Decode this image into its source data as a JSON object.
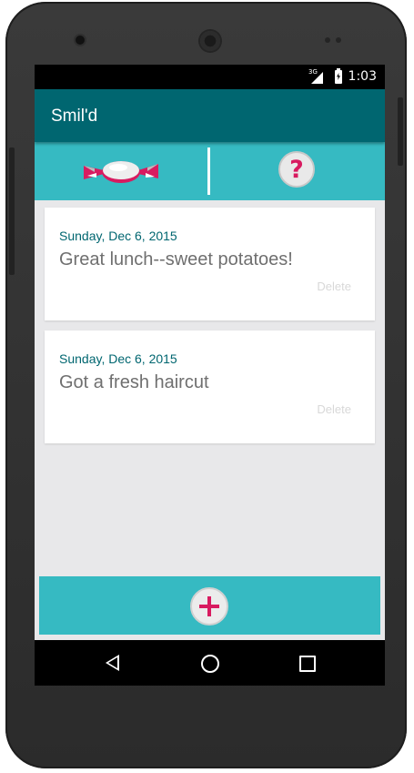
{
  "status_bar": {
    "network_label": "3G",
    "time": "1:03",
    "icons": [
      "signal-3g-icon",
      "battery-charging-icon"
    ]
  },
  "app_bar": {
    "title": "Smil'd",
    "background_color": "#006670"
  },
  "tabs": [
    {
      "name": "candy",
      "icon": "candy-icon",
      "selected": true
    },
    {
      "name": "help",
      "icon": "question-icon",
      "glyph": "?",
      "selected": false
    }
  ],
  "entries": [
    {
      "date": "Sunday, Dec 6, 2015",
      "text": "Great lunch--sweet potatoes!",
      "delete_label": "Delete"
    },
    {
      "date": "Sunday, Dec 6, 2015",
      "text": "Got a fresh haircut",
      "delete_label": "Delete"
    }
  ],
  "add_button": {
    "icon": "plus-icon"
  },
  "nav_bar": {
    "icons": [
      "back-icon",
      "home-icon",
      "recents-icon"
    ]
  },
  "colors": {
    "accent_teal": "#36bac2",
    "dark_teal": "#006670",
    "pink": "#d81b60",
    "background": "#e8e8ea"
  }
}
